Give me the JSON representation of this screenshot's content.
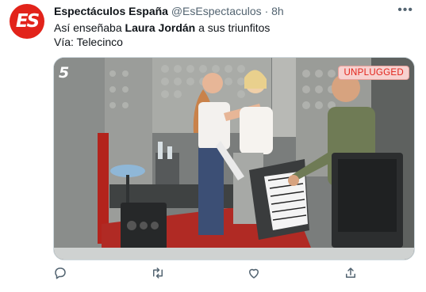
{
  "tweet": {
    "avatar_text": "ES",
    "display_name": "Espectáculos España",
    "handle": "@EsEspectaculos",
    "separator": "·",
    "time": "8h",
    "more_label": "•••",
    "text_prefix": "Así enseñaba ",
    "text_bold": "Laura Jordán",
    "text_suffix": " a sus triunfitos",
    "via": "Vía: Telecinco"
  },
  "media": {
    "channel_logo": "5",
    "badge": "UNPLUGGED"
  },
  "actions": {
    "icons": [
      "reply-icon",
      "retweet-icon",
      "like-icon",
      "share-icon"
    ]
  },
  "colors": {
    "brand": "#e2231a",
    "secondary_text": "#536471",
    "badge_bg": "#f7d1cf"
  }
}
